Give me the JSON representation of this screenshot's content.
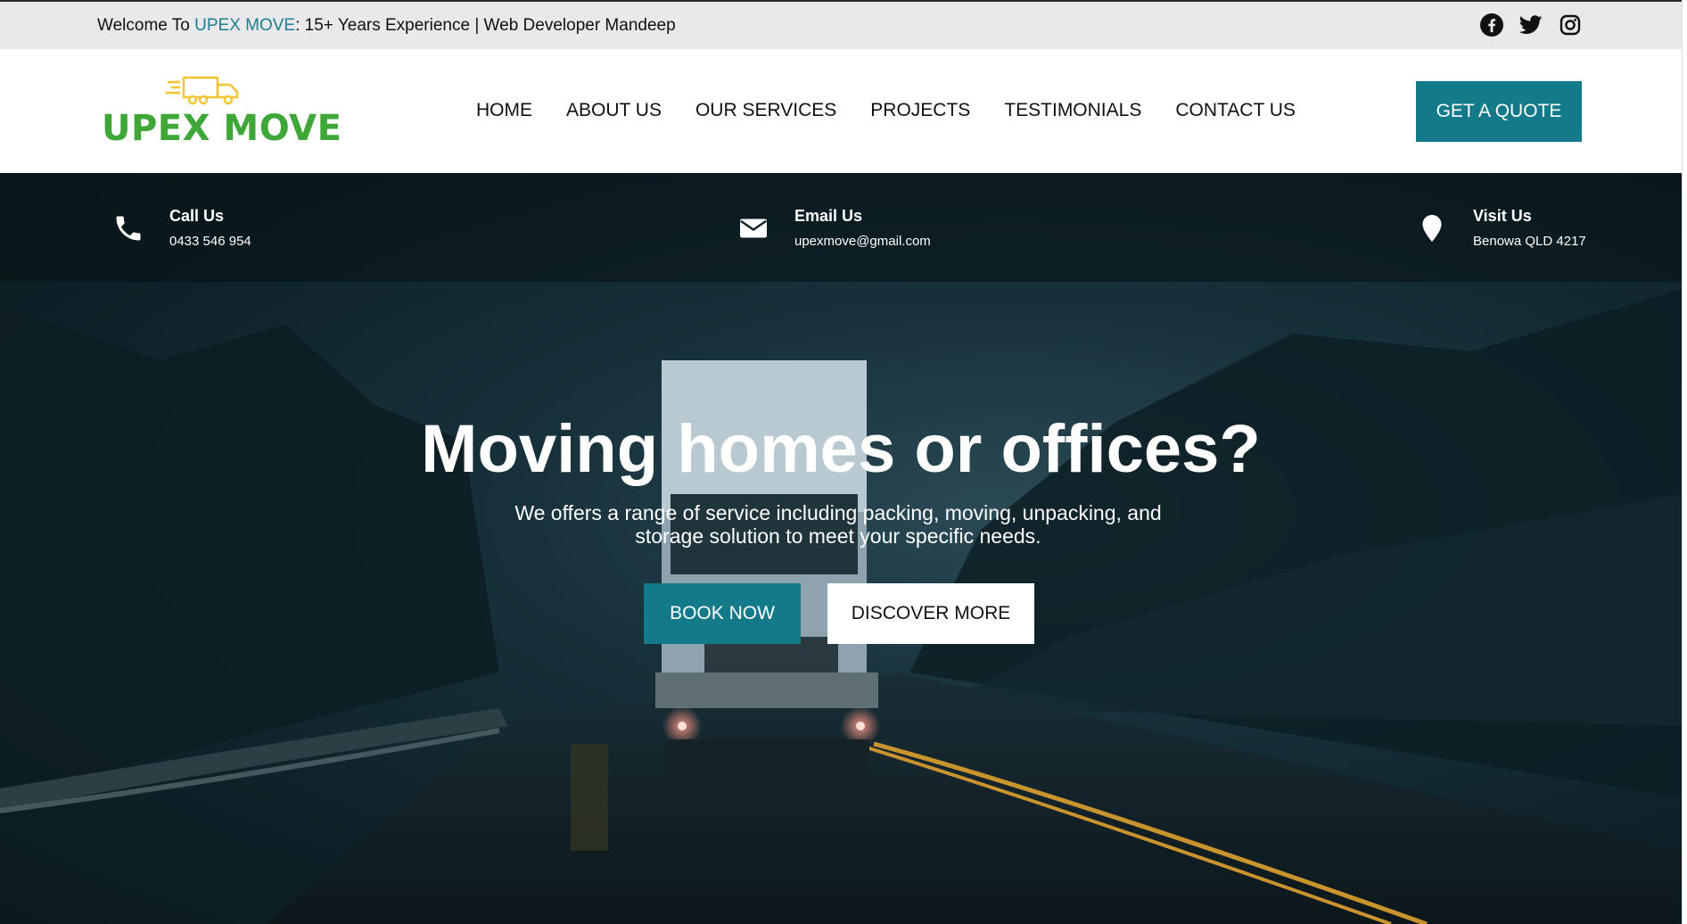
{
  "topbar": {
    "welcome_prefix": "Welcome To ",
    "brand": "UPEX MOVE",
    "welcome_suffix": ": 15+ Years Experience | Web Developer Mandeep",
    "socials": [
      "facebook-icon",
      "twitter-icon",
      "instagram-icon"
    ]
  },
  "header": {
    "logo_text": "UPEX MOVE",
    "nav": [
      "HOME",
      "ABOUT US",
      "OUR SERVICES",
      "PROJECTS",
      "TESTIMONIALS",
      "CONTACT US"
    ],
    "cta": "GET A QUOTE"
  },
  "contact": {
    "call_title": "Call Us",
    "call_value": "0433 546 954",
    "email_title": "Email Us",
    "email_value": "upexmove@gmail.com",
    "visit_title": "Visit Us",
    "visit_value": "Benowa QLD 4217"
  },
  "hero": {
    "title": "Moving homes or offices?",
    "subtitle": "We offers a range of service including packing, moving, unpacking, and storage solution to meet your specific needs.",
    "book_label": "BOOK NOW",
    "discover_label": "DISCOVER MORE"
  },
  "colors": {
    "accent": "#137a89",
    "brand_green": "#3ea737",
    "truck_yellow": "#f2c230",
    "topbar_bg": "#e9e8ea"
  }
}
